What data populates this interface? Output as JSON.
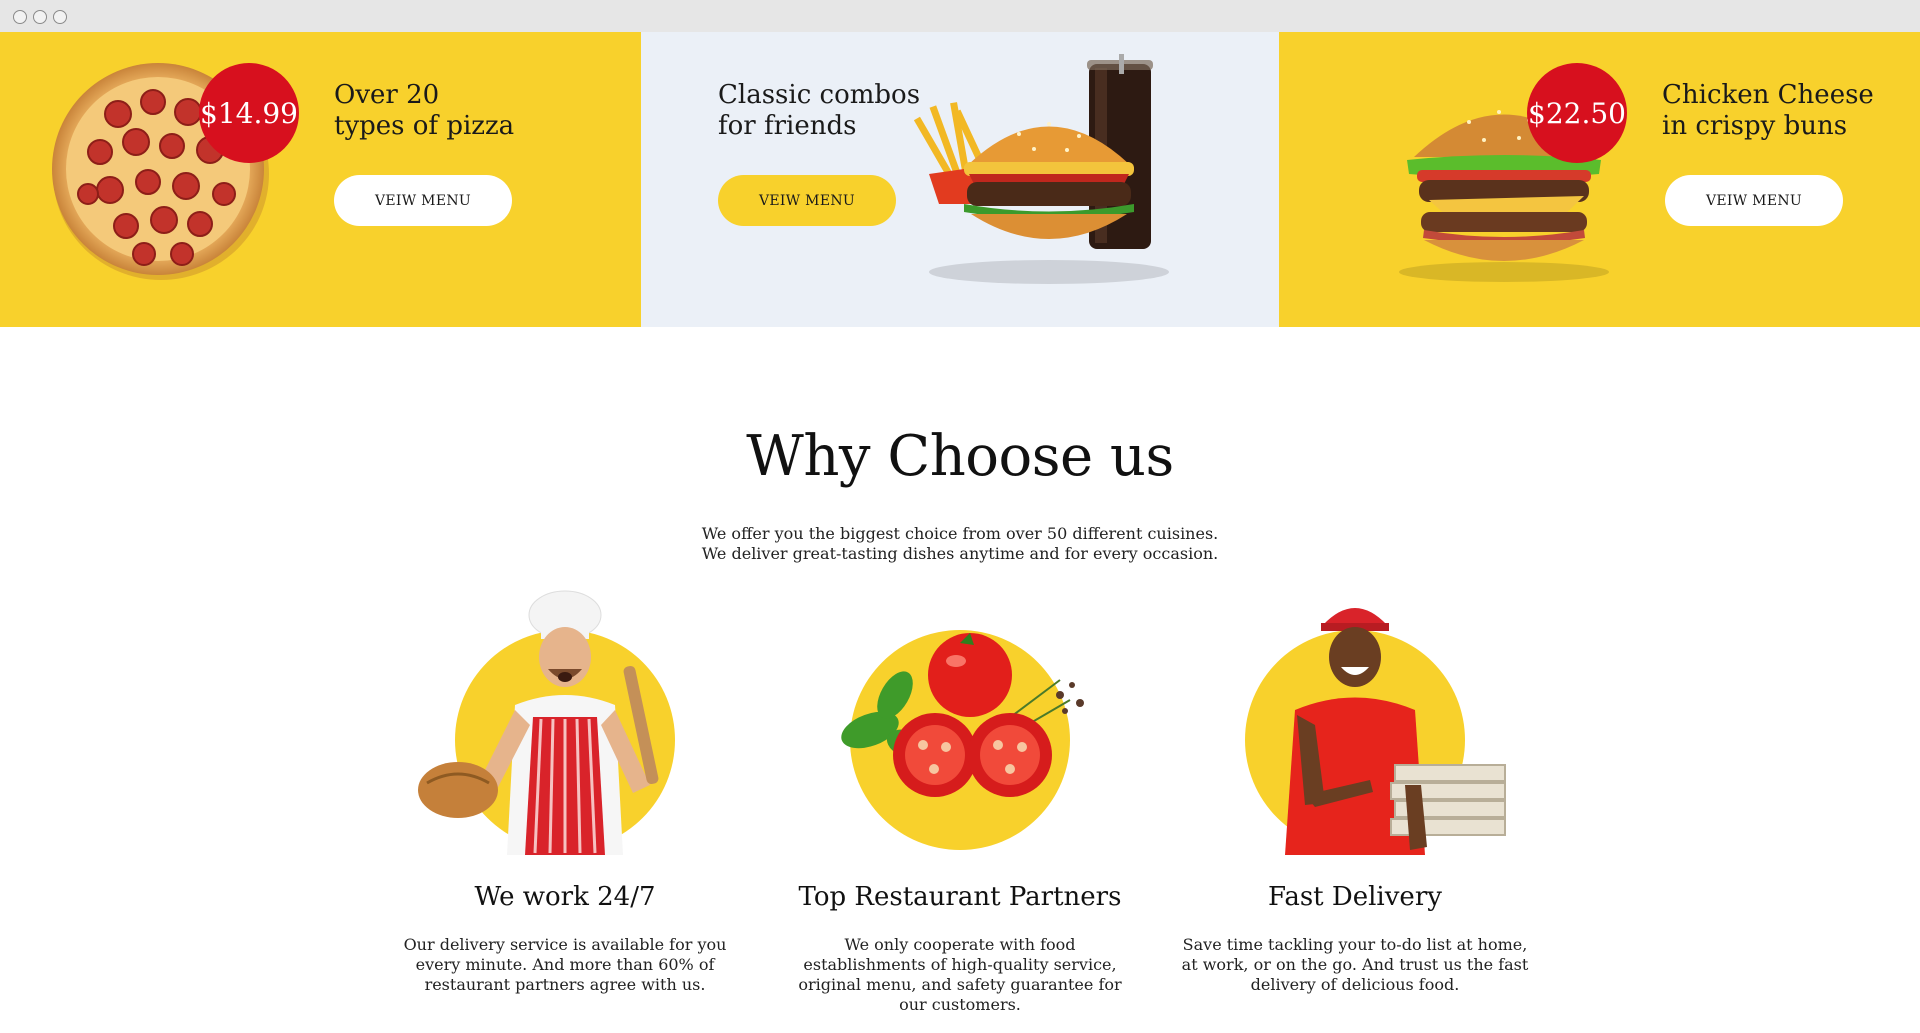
{
  "promos": [
    {
      "title": "Over 20\ntypes of pizza",
      "button": "VEIW MENU",
      "price": "$14.99"
    },
    {
      "title": "Classic combos\nfor friends",
      "button": "VEIW MENU"
    },
    {
      "title": "Chicken Cheese\nin crispy buns",
      "button": "VEIW MENU",
      "price": "$22.50"
    }
  ],
  "why": {
    "title": "Why Choose us",
    "subtitle": "We offer you the biggest choice from over 50 different cuisines.\nWe deliver great-tasting dishes anytime and for every occasion.",
    "features": [
      {
        "title": "We work 24/7",
        "description": "Our delivery service is available for you every minute. And more than 60% of restaurant partners agree with us."
      },
      {
        "title": "Top Restaurant Partners",
        "description": "We only cooperate with food establishments of high-quality service, original menu, and safety guarantee for our customers."
      },
      {
        "title": "Fast Delivery",
        "description": "Save time tackling your to-do list at home, at work, or on the go. And trust us the fast delivery of delicious food."
      }
    ]
  },
  "colors": {
    "yellow": "#f8d12c",
    "red": "#d7101e",
    "light_blue": "#ebf0f7"
  },
  "icons": [
    "pizza-image",
    "burger-combo-image",
    "chicken-burger-image",
    "chef-image",
    "tomato-image",
    "courier-image"
  ]
}
